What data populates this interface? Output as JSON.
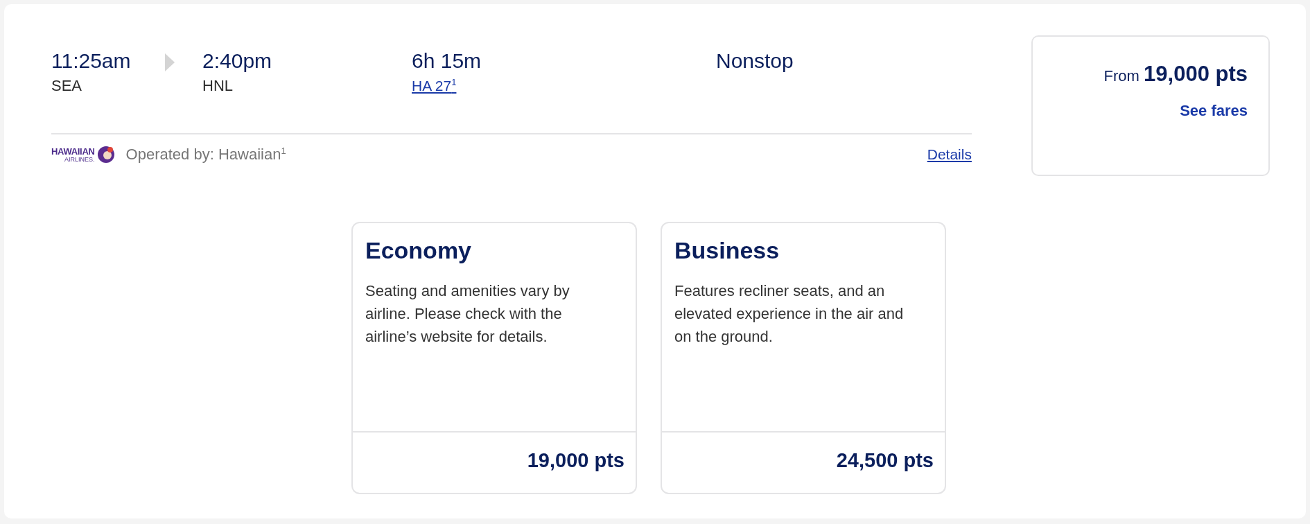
{
  "flight": {
    "depart_time": "11:25am",
    "depart_airport": "SEA",
    "arrive_time": "2:40pm",
    "arrive_airport": "HNL",
    "duration": "6h 15m",
    "flight_number": "HA 27$^{1}$",
    "stops": "Nonstop"
  },
  "operator": {
    "logo_name": "HAWAIIAN",
    "logo_sub": "AIRLINES.",
    "text": "Operated by: Hawaiian$^{1}$",
    "details_link": "Details"
  },
  "price_box": {
    "from": "From **19,000 pts**",
    "link": "See fares"
  },
  "fares": [
    {
      "title": "Economy",
      "description": "Seating and amenities vary by airline. Please check with the airline’s website for details.",
      "price": "19,000 pts"
    },
    {
      "title": "Business",
      "description": "Features recliner seats, and an elevated experience in the air and on the ground.",
      "price": "24,500 pts"
    }
  ]
}
